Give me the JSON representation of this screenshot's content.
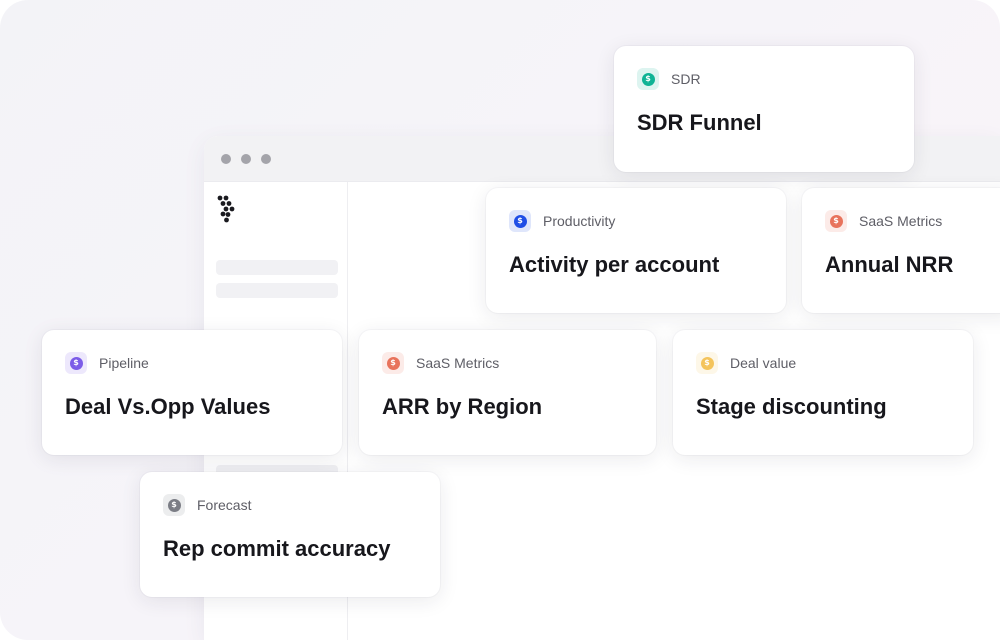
{
  "browser": {
    "window_controls": [
      "close",
      "minimize",
      "maximize"
    ]
  },
  "colors": {
    "teal": "#10b395",
    "blue": "#1f4ee6",
    "coral": "#e8735c",
    "purple": "#7c5ce8",
    "yellow": "#f4c45c",
    "gray": "#7b7d85"
  },
  "cards": [
    {
      "category": "SDR",
      "title": "SDR Funnel",
      "icon": "dollar-icon",
      "color": "teal"
    },
    {
      "category": "Productivity",
      "title": "Activity per account",
      "icon": "dollar-icon",
      "color": "blue"
    },
    {
      "category": "SaaS Metrics",
      "title": "Annual NRR",
      "icon": "dollar-icon",
      "color": "coral"
    },
    {
      "category": "Pipeline",
      "title": "Deal Vs.Opp Values",
      "icon": "dollar-icon",
      "color": "purple"
    },
    {
      "category": "SaaS Metrics",
      "title": "ARR by Region",
      "icon": "dollar-icon",
      "color": "coral"
    },
    {
      "category": "Deal value",
      "title": "Stage discounting",
      "icon": "dollar-icon",
      "color": "yellow"
    },
    {
      "category": "Forecast",
      "title": "Rep commit accuracy",
      "icon": "dollar-icon",
      "color": "gray"
    }
  ]
}
